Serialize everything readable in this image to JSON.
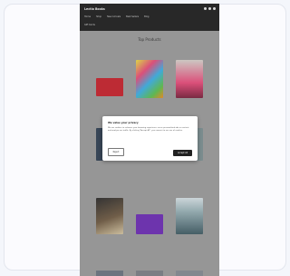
{
  "site": {
    "brand": "Lectio Books",
    "nav": [
      "Home",
      "Shop",
      "New Arrivals",
      "Best Sellers",
      "Blog"
    ],
    "subnav": "Gift Cards",
    "section_title": "Top Products"
  },
  "modal": {
    "title": "We value your privacy",
    "body": "We use cookies to enhance your browsing experience, serve personalized ads or content, and analyze our traffic. By clicking \"Accept All\", you consent to our use of cookies.",
    "decline_label": "Reject",
    "accept_label": "Accept All"
  },
  "products": [
    {
      "title": "",
      "price": "",
      "color": "#c7202b"
    },
    {
      "title": "",
      "price": "",
      "color": "#e7e241"
    },
    {
      "title": "",
      "price": "",
      "color": "#e84a7a"
    },
    {
      "title": "",
      "price": "",
      "color": "#2f3f53"
    },
    {
      "title": "",
      "price": "",
      "color": "#b9c2c6"
    },
    {
      "title": "",
      "price": "",
      "color": "#7c8f91"
    },
    {
      "title": "",
      "price": "",
      "color": "#2b2a2a"
    },
    {
      "title": "",
      "price": "",
      "color": "#6b2bb4"
    },
    {
      "title": "",
      "price": "",
      "color": "#9ab3b8"
    }
  ]
}
